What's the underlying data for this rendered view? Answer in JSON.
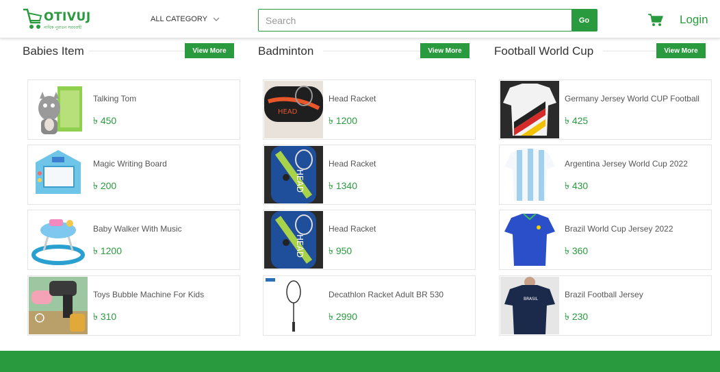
{
  "brand": {
    "name": "OTIVUJ",
    "tagline": "নাবিক পুরাতন সরবরাহী",
    "color": "#2a9a3e"
  },
  "header": {
    "category_label": "ALL CATEGORY",
    "search_placeholder": "Search",
    "go_label": "Go",
    "cart_icon": "shopping-cart-icon",
    "login_label": "Login"
  },
  "sections": [
    {
      "title": "Babies Item",
      "view_more": "View More",
      "products": [
        {
          "name": "Talking Tom",
          "price": "৳ 450",
          "image": "talking-tom-toy"
        },
        {
          "name": "Magic Writing Board",
          "price": "৳ 200",
          "image": "magic-writing-board"
        },
        {
          "name": "Baby Walker With Music",
          "price": "৳ 1200",
          "image": "baby-walker"
        },
        {
          "name": "Toys Bubble Machine For Kids",
          "price": "৳ 310",
          "image": "bubble-machine"
        }
      ]
    },
    {
      "title": "Badminton",
      "view_more": "View More",
      "products": [
        {
          "name": "Head Racket",
          "price": "৳ 1200",
          "image": "head-racket-bag"
        },
        {
          "name": "Head Racket",
          "price": "৳ 1340",
          "image": "head-racket-blue"
        },
        {
          "name": "Head Racket",
          "price": "৳ 950",
          "image": "head-racket-blue"
        },
        {
          "name": "Decathlon Racket Adult BR 530",
          "price": "৳ 2990",
          "image": "decathlon-racket"
        }
      ]
    },
    {
      "title": "Football World Cup",
      "view_more": "View More",
      "products": [
        {
          "name": "Germany Jersey World CUP Football",
          "price": "৳ 425",
          "image": "germany-jersey"
        },
        {
          "name": "Argentina Jersey World Cup 2022",
          "price": "৳ 430",
          "image": "argentina-jersey"
        },
        {
          "name": "Brazil World Cup Jersey 2022",
          "price": "৳ 360",
          "image": "brazil-blue-jersey"
        },
        {
          "name": "Brazil Football Jersey",
          "price": "৳ 230",
          "image": "brazil-navy-jersey"
        }
      ]
    }
  ]
}
